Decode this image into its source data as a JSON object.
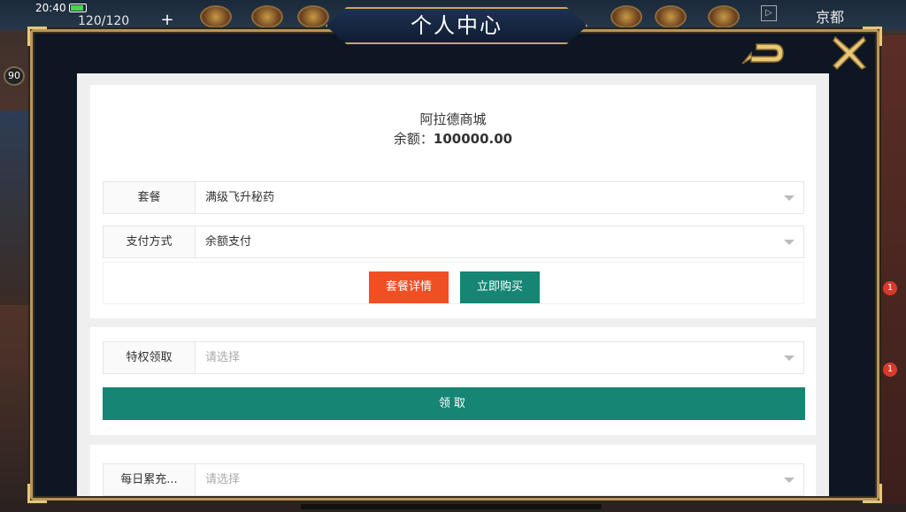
{
  "hud": {
    "time": "20:40",
    "stamina": "120/120",
    "plus": "+",
    "city": "京都",
    "level": "90",
    "menu_glyph": "▷",
    "notification_count": "1"
  },
  "modal": {
    "title": "个人中心"
  },
  "shop": {
    "name": "阿拉德商城",
    "balance_label": "余额：",
    "balance_value": "100000.00"
  },
  "form": {
    "package_label": "套餐",
    "package_value": "满级飞升秘药",
    "payment_label": "支付方式",
    "payment_value": "余额支付"
  },
  "buttons": {
    "detail": "套餐详情",
    "buy": "立即购买",
    "claim": "领取"
  },
  "privilege": {
    "label": "特权领取",
    "placeholder": "请选择"
  },
  "daily": {
    "label": "每日累充...",
    "placeholder": "请选择"
  },
  "colors": {
    "accent_orange": "#f04f24",
    "accent_teal": "#168574",
    "frame_gold": "#b8955a"
  }
}
